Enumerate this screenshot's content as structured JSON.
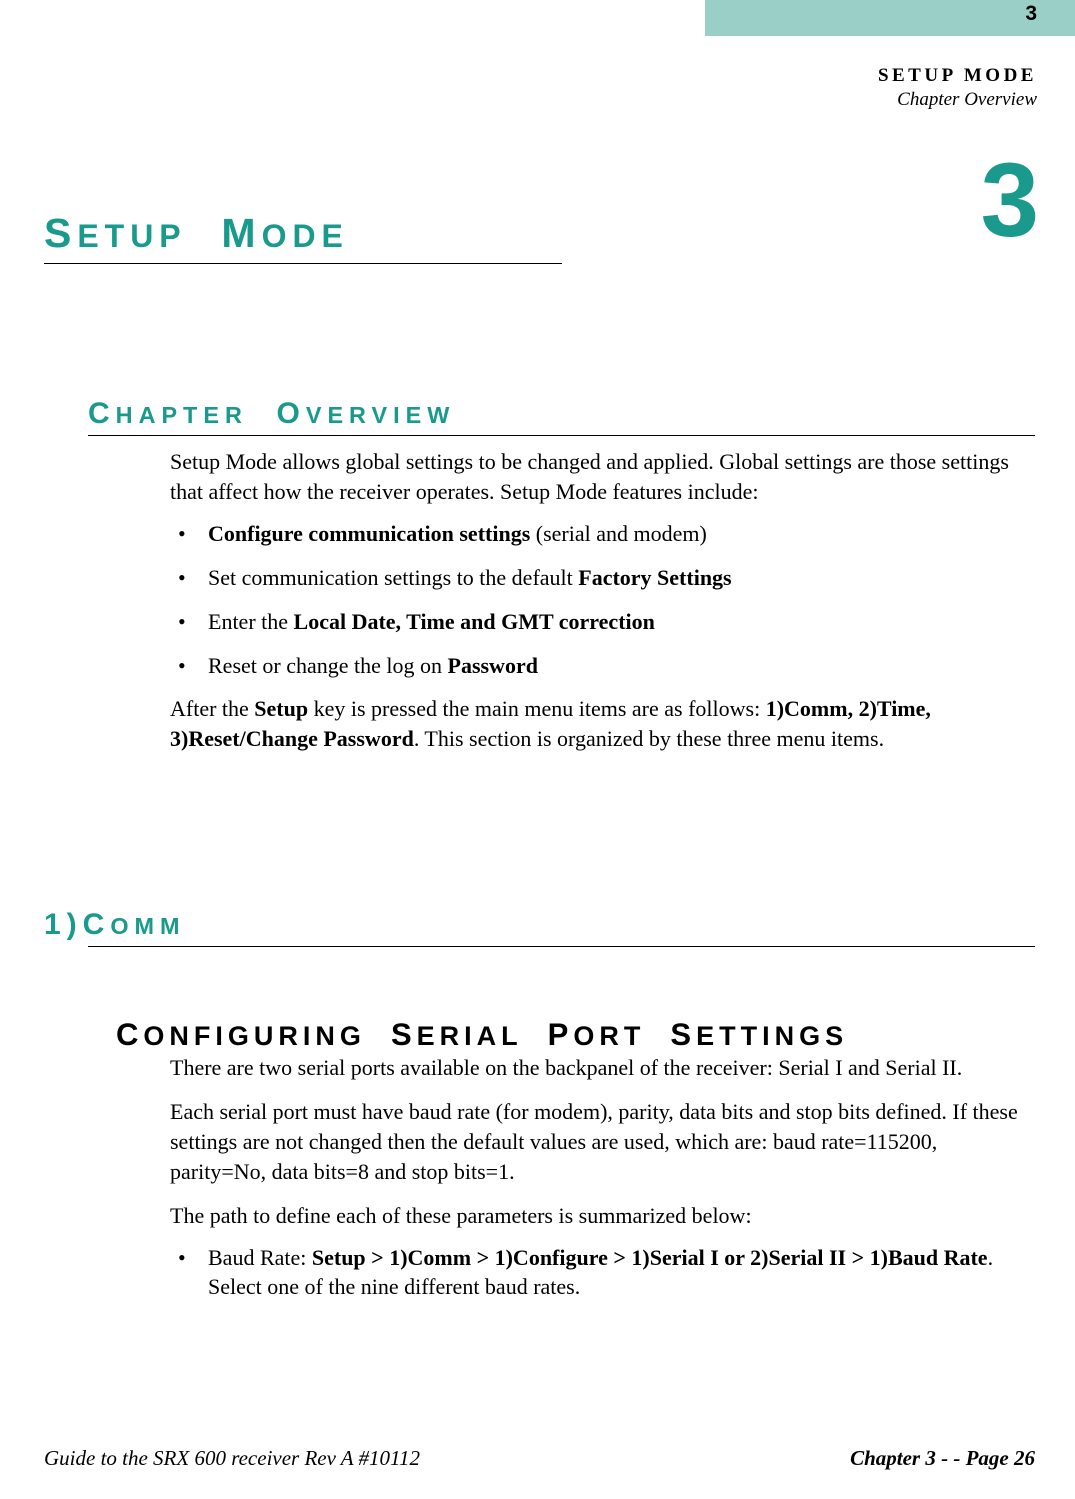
{
  "page_number_top": "3",
  "header_title": "SETUP MODE",
  "header_subtitle": "Chapter Overview",
  "chapter_number_large": "3",
  "chapter_title_parts": {
    "word1": "S",
    "word1_rest": "ETUP",
    "word2": "M",
    "word2_rest": "ODE"
  },
  "section_overview_parts": {
    "w1a": "C",
    "w1b": "HAPTER",
    "w2a": "O",
    "w2b": "VERVIEW"
  },
  "overview_intro": "Setup Mode allows global settings to be changed and applied. Global settings are those settings that affect how the receiver operates. Setup Mode features include:",
  "overview_bullets": {
    "b1_bold": "Configure communication settings",
    "b1_rest": " (serial and modem)",
    "b2_pre": "Set communication settings to the default ",
    "b2_bold": "Factory Settings",
    "b3_pre": "Enter the ",
    "b3_bold": "Local Date, Time and GMT correction",
    "b4_pre": "Reset or change the log on ",
    "b4_bold": "Password"
  },
  "overview_after": {
    "p1": "After the ",
    "p1_bold1": "Setup",
    "p2": " key is pressed the main menu items are as follows: ",
    "p2_bold2": "1)Comm, 2)Time, 3)Reset/Change Password",
    "p3": ". This section is organized by these three menu items."
  },
  "section_comm_parts": {
    "a": "1)C",
    "b": "OMM"
  },
  "sub_heading_parts": {
    "w1a": "C",
    "w1b": "ONFIGURING",
    "w2a": "S",
    "w2b": "ERIAL",
    "w3a": "P",
    "w3b": "ORT",
    "w4a": "S",
    "w4b": "ETTINGS"
  },
  "serial_p1": "There are two serial ports available on the backpanel of the receiver: Serial I and Serial II.",
  "serial_p2": "Each serial port must have baud rate (for modem), parity, data bits and stop bits defined. If these settings are not changed then the default values are used, which are: baud rate=115200, parity=No, data bits=8 and stop bits=1.",
  "serial_p3": "The path to define each of these parameters is summarized below:",
  "serial_bullet": {
    "pre": "Baud Rate: ",
    "bold": "Setup > 1)Comm > 1)Configure > 1)Serial I or 2)Serial II > 1)Baud Rate",
    "post": ". Select one of the nine different baud rates."
  },
  "footer_left": "Guide to the SRX 600 receiver Rev A #10112",
  "footer_right": "Chapter 3 - - Page 26"
}
